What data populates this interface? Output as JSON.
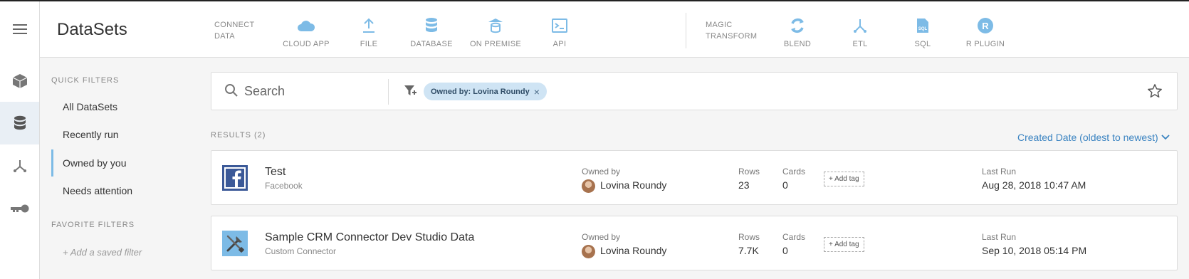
{
  "header": {
    "title": "DataSets",
    "connect_label": "CONNECT\nDATA",
    "transform_label": "MAGIC\nTRANSFORM",
    "connect_tools": [
      {
        "label": "CLOUD APP",
        "icon": "cloud-icon"
      },
      {
        "label": "FILE",
        "icon": "upload-icon"
      },
      {
        "label": "DATABASE",
        "icon": "database-icon"
      },
      {
        "label": "ON PREMISE",
        "icon": "on-premise-icon"
      },
      {
        "label": "API",
        "icon": "terminal-icon"
      }
    ],
    "transform_tools": [
      {
        "label": "BLEND",
        "icon": "blend-icon"
      },
      {
        "label": "ETL",
        "icon": "etl-icon"
      },
      {
        "label": "SQL",
        "icon": "sql-icon",
        "badge": "SQL"
      },
      {
        "label": "R PLUGIN",
        "icon": "r-plugin-icon",
        "badge": "R"
      }
    ],
    "accent_color": "#7dbbe6"
  },
  "rail": {
    "items": [
      {
        "icon": "menu-icon"
      },
      {
        "icon": "cube-icon"
      },
      {
        "icon": "database-icon",
        "active": true
      },
      {
        "icon": "dataflow-icon"
      },
      {
        "icon": "key-icon"
      }
    ]
  },
  "filters": {
    "quick_label": "QUICK FILTERS",
    "items": [
      {
        "label": "All DataSets"
      },
      {
        "label": "Recently run"
      },
      {
        "label": "Owned by you",
        "active": true
      },
      {
        "label": "Needs attention"
      }
    ],
    "favorite_label": "FAVORITE FILTERS",
    "add_saved": "+ Add a saved filter"
  },
  "search": {
    "placeholder": "Search",
    "chip_prefix": "Owned by:",
    "chip_value": "Lovina Roundy",
    "chip_close": "×"
  },
  "results": {
    "label": "RESULTS (2)",
    "sort_label": "Created Date (oldest to newest)",
    "columns": {
      "owned_by": "Owned by",
      "rows": "Rows",
      "cards": "Cards",
      "last_run": "Last Run",
      "add_tag": "+ Add tag"
    },
    "rows": [
      {
        "name": "Test",
        "type": "Facebook",
        "icon": "facebook-icon",
        "owner": "Lovina Roundy",
        "rows": "23",
        "cards": "0",
        "last_run": "Aug 28, 2018 10:47 AM"
      },
      {
        "name": "Sample CRM Connector Dev Studio Data",
        "type": "Custom Connector",
        "icon": "tools-icon",
        "owner": "Lovina Roundy",
        "rows": "7.7K",
        "cards": "0",
        "last_run": "Sep 10, 2018 05:14 PM"
      }
    ]
  }
}
